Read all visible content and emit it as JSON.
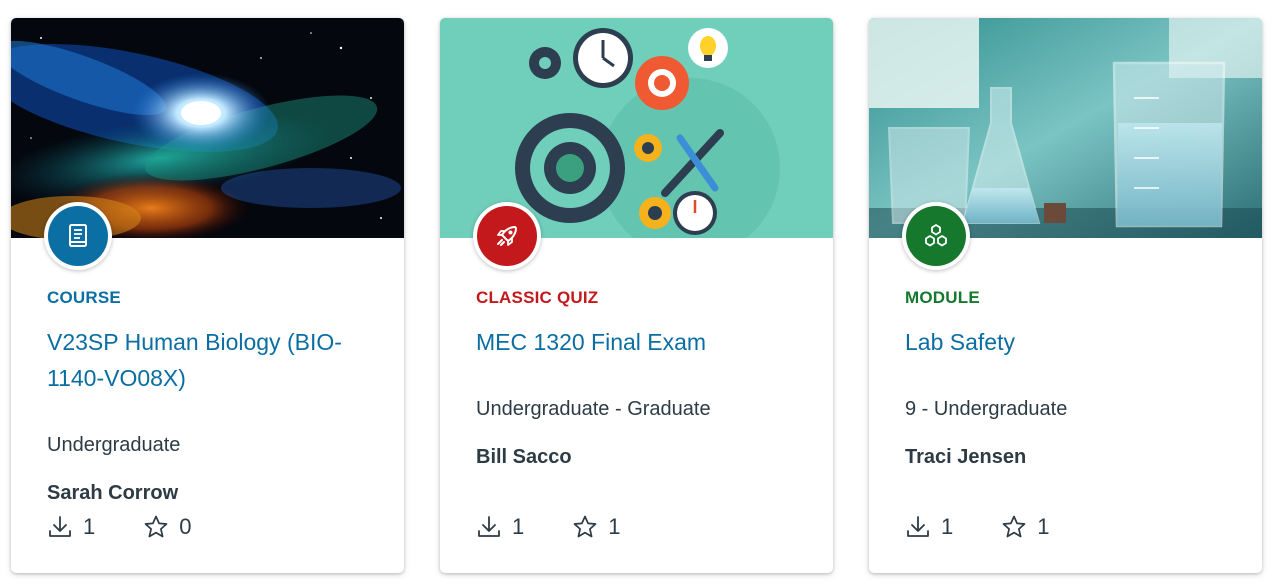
{
  "cards": [
    {
      "type_label": "COURSE",
      "type_color": "#0b6fa4",
      "type_icon": "book-icon",
      "title": "V23SP Human Biology (BIO-1140-VO08X)",
      "meta": "Undergraduate",
      "author": "Sarah Corrow",
      "downloads": "1",
      "favorites": "0",
      "image": "galaxy-image"
    },
    {
      "type_label": "CLASSIC QUIZ",
      "type_color": "#c3191c",
      "type_icon": "rocket-icon",
      "title": "MEC 1320 Final Exam",
      "meta": "Undergraduate - Graduate",
      "author": "Bill Sacco",
      "downloads": "1",
      "favorites": "1",
      "image": "gears-image"
    },
    {
      "type_label": "MODULE",
      "type_color": "#16782c",
      "type_icon": "module-icon",
      "title": "Lab Safety",
      "meta": "9 - Undergraduate",
      "author": "Traci Jensen",
      "downloads": "1",
      "favorites": "1",
      "image": "lab-glassware-image"
    }
  ]
}
